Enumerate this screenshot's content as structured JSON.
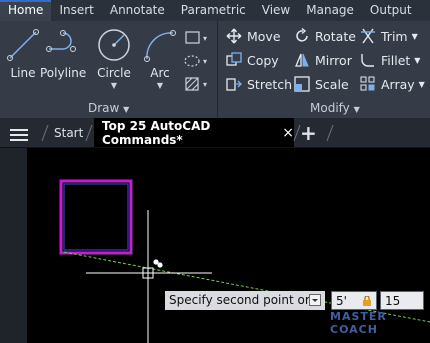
{
  "ribbon_tabs": [
    "Home",
    "Insert",
    "Annotate",
    "Parametric",
    "View",
    "Manage",
    "Output"
  ],
  "active_tab": "Home",
  "draw_panel": {
    "title": "Draw",
    "tools": [
      "Line",
      "Polyline",
      "Circle",
      "Arc"
    ]
  },
  "modify_panel": {
    "title": "Modify",
    "tools": [
      "Move",
      "Rotate",
      "Trim",
      "Copy",
      "Mirror",
      "Fillet",
      "Stretch",
      "Scale",
      "Array"
    ]
  },
  "doc_tabs": {
    "start": "Start",
    "active": "Top 25 AutoCAD Commands*",
    "close": "×",
    "new": "+"
  },
  "command_prompt": {
    "text": "Specify second point or",
    "value1": "5'",
    "value2": "15"
  },
  "watermark": "MASTER COACH",
  "colors": {
    "accent": "#2c6ed5",
    "rectangle_outer": "#c21fd1",
    "rectangle_inner": "#3a3fbf",
    "rubberband": "#7ad04f"
  }
}
